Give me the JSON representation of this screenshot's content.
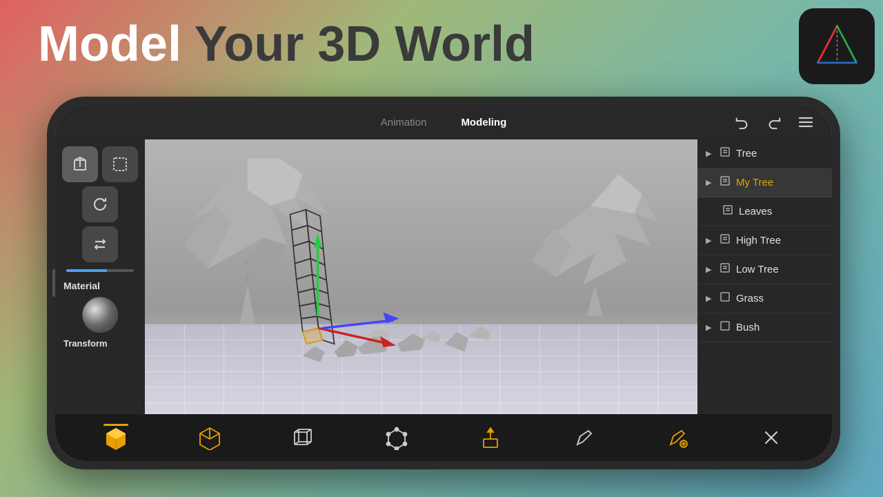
{
  "header": {
    "bold_text": "Model",
    "thin_text": " Your 3D World"
  },
  "tabs": {
    "animation": "Animation",
    "modeling": "Modeling",
    "active": "modeling"
  },
  "toolbar": {
    "material_label": "Material",
    "transform_label": "Transform"
  },
  "panel": {
    "items": [
      {
        "id": "tree",
        "label": "Tree",
        "arrow": true,
        "icon": "📄",
        "indent": false,
        "selected": false,
        "highlight": false
      },
      {
        "id": "my-tree",
        "label": "My Tree",
        "arrow": true,
        "icon": "📄",
        "indent": false,
        "selected": true,
        "highlight": true
      },
      {
        "id": "leaves",
        "label": "Leaves",
        "arrow": false,
        "icon": "📄",
        "indent": true,
        "selected": false,
        "highlight": false
      },
      {
        "id": "high-tree",
        "label": "High Tree",
        "arrow": true,
        "icon": "📄",
        "indent": false,
        "selected": false,
        "highlight": false
      },
      {
        "id": "low-tree",
        "label": "Low Tree",
        "arrow": true,
        "icon": "📄",
        "indent": false,
        "selected": false,
        "highlight": false
      },
      {
        "id": "grass",
        "label": "Grass",
        "arrow": true,
        "icon": "📄",
        "indent": false,
        "selected": false,
        "highlight": false
      },
      {
        "id": "bush",
        "label": "Bush",
        "arrow": true,
        "icon": "📄",
        "indent": false,
        "selected": false,
        "highlight": false
      }
    ]
  },
  "bottom_tools": [
    "cube-solid",
    "cube-orange",
    "cube-wire",
    "cube-corner",
    "extrude",
    "pencil",
    "pencil-edit",
    "close"
  ],
  "logo": {
    "alt": "3D App Logo"
  }
}
